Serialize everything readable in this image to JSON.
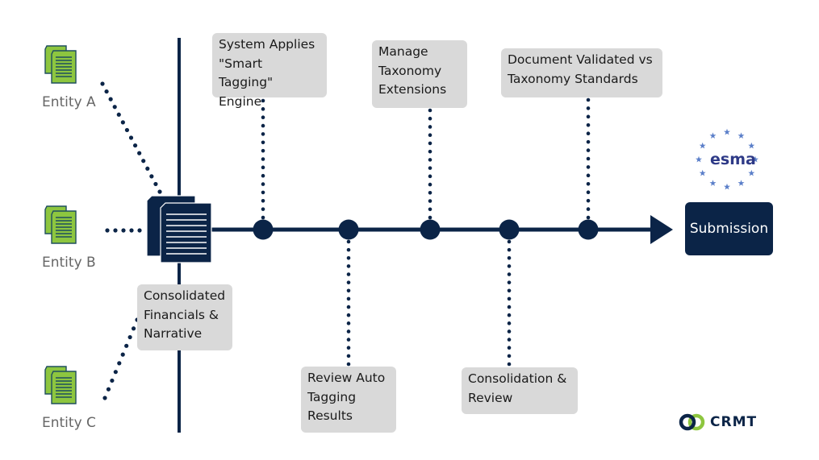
{
  "colors": {
    "navy": "#0b2447",
    "green": "#8dc63f",
    "box_gray": "#d9d9d9",
    "label_gray": "#666666",
    "esma_blue": "#2e3a87",
    "esma_star": "#5b7fc9"
  },
  "entities": [
    {
      "label": "Entity A",
      "icon": "document-stack-icon"
    },
    {
      "label": "Entity B",
      "icon": "document-stack-icon"
    },
    {
      "label": "Entity C",
      "icon": "document-stack-icon"
    }
  ],
  "consolidated": {
    "label": "Consolidated Financials & Narrative",
    "lines": [
      "Consolidated",
      "Financials &",
      "Narrative"
    ]
  },
  "steps_top": [
    {
      "lines": [
        "System Applies",
        "\"Smart Tagging\"",
        "Engine"
      ]
    },
    {
      "lines": [
        "Manage",
        "Taxonomy",
        "Extensions"
      ]
    },
    {
      "lines": [
        "Document Validated vs",
        "Taxonomy Standards"
      ]
    }
  ],
  "steps_bottom": [
    {
      "lines": [
        "Review Auto",
        "Tagging",
        "Results"
      ]
    },
    {
      "lines": [
        "Consolidation &",
        "Review"
      ]
    }
  ],
  "timeline_order": [
    "System Applies \"Smart Tagging\" Engine",
    "Review Auto Tagging Results",
    "Manage Taxonomy Extensions",
    "Consolidation & Review",
    "Document Validated vs Taxonomy Standards"
  ],
  "submission": {
    "label": "Submission"
  },
  "esma_logo": {
    "text": "esma",
    "stars": 12
  },
  "crmt_logo": {
    "text": "CRMT"
  }
}
